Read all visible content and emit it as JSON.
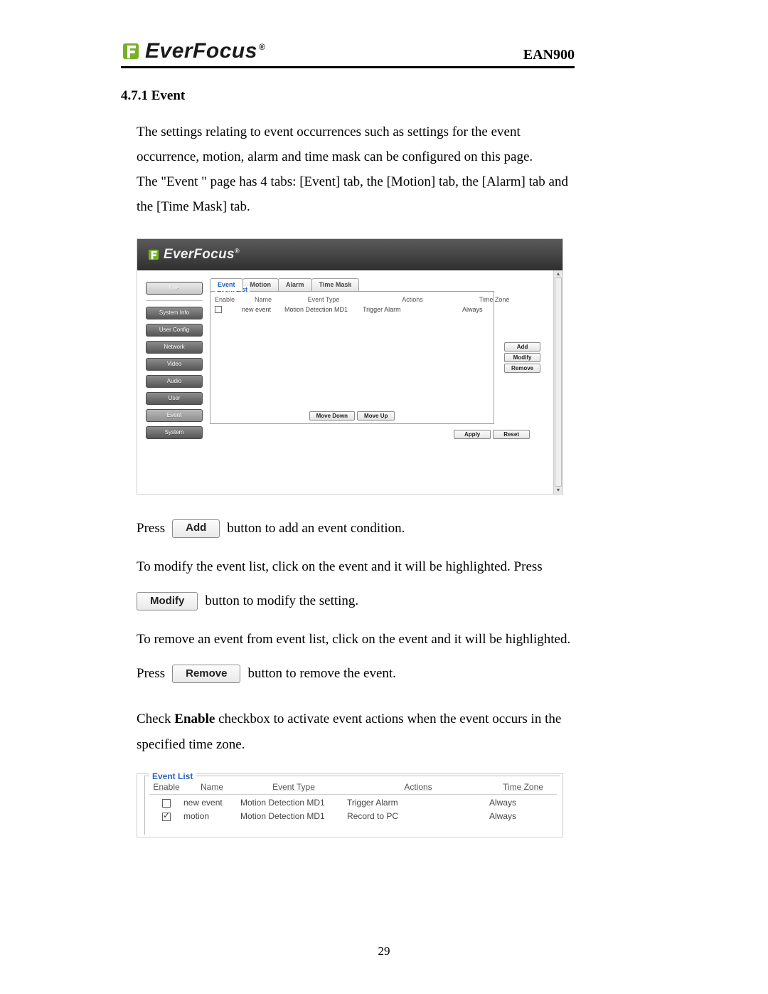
{
  "header": {
    "brand": "EverFocus",
    "model": "EAN900"
  },
  "section": {
    "number_title": "4.7.1 Event"
  },
  "para1": "The settings relating to event occurrences such as settings for the event occurrence, motion, alarm and time mask can be configured on this page.",
  "para2": "The \"Event \" page has 4 tabs: [Event] tab, the [Motion] tab, the [Alarm] tab and the [Time Mask] tab.",
  "screenshot1": {
    "brand": "EverFocus",
    "sidebar": {
      "items": [
        "Live",
        "System Info",
        "User Config",
        "Network",
        "Video",
        "Audio",
        "User",
        "Event",
        "System"
      ]
    },
    "tabs": [
      "Event",
      "Motion",
      "Alarm",
      "Time Mask"
    ],
    "fieldset_label": "Event List",
    "columns": [
      "Enable",
      "Name",
      "Event Type",
      "Actions",
      "Time Zone"
    ],
    "rows": [
      {
        "enable": false,
        "name": "new event",
        "event_type": "Motion Detection MD1",
        "actions": "Trigger Alarm",
        "time_zone": "Always"
      }
    ],
    "side_buttons": [
      "Add",
      "Modify",
      "Remove"
    ],
    "move_buttons": [
      "Move Down",
      "Move Up"
    ],
    "footer_buttons": [
      "Apply",
      "Reset"
    ]
  },
  "instructions": {
    "press1_a": "Press",
    "press1_b": "button to add an event condition.",
    "mod_line": "To modify the event list, click on the event and it will be highlighted. Press",
    "mod_btn_after": "button to modify the setting.",
    "remove_line": "To remove an event from event list, click on the event and it will be highlighted.",
    "press_remove_a": "Press",
    "press_remove_b": "button to remove the event.",
    "enable_line_a": "Check ",
    "enable_bold": "Enable",
    "enable_line_b": " checkbox to activate event actions when the event occurs in the specified time zone.",
    "btn_add": "Add",
    "btn_modify": "Modify",
    "btn_remove": "Remove"
  },
  "screenshot2": {
    "fieldset_label": "Event List",
    "columns": [
      "Enable",
      "Name",
      "Event Type",
      "Actions",
      "Time Zone"
    ],
    "rows": [
      {
        "enable": false,
        "name": "new event",
        "event_type": "Motion Detection MD1",
        "actions": "Trigger Alarm",
        "time_zone": "Always"
      },
      {
        "enable": true,
        "name": "motion",
        "event_type": "Motion Detection MD1",
        "actions": "Record to PC",
        "time_zone": "Always"
      }
    ]
  },
  "page_number": "29"
}
